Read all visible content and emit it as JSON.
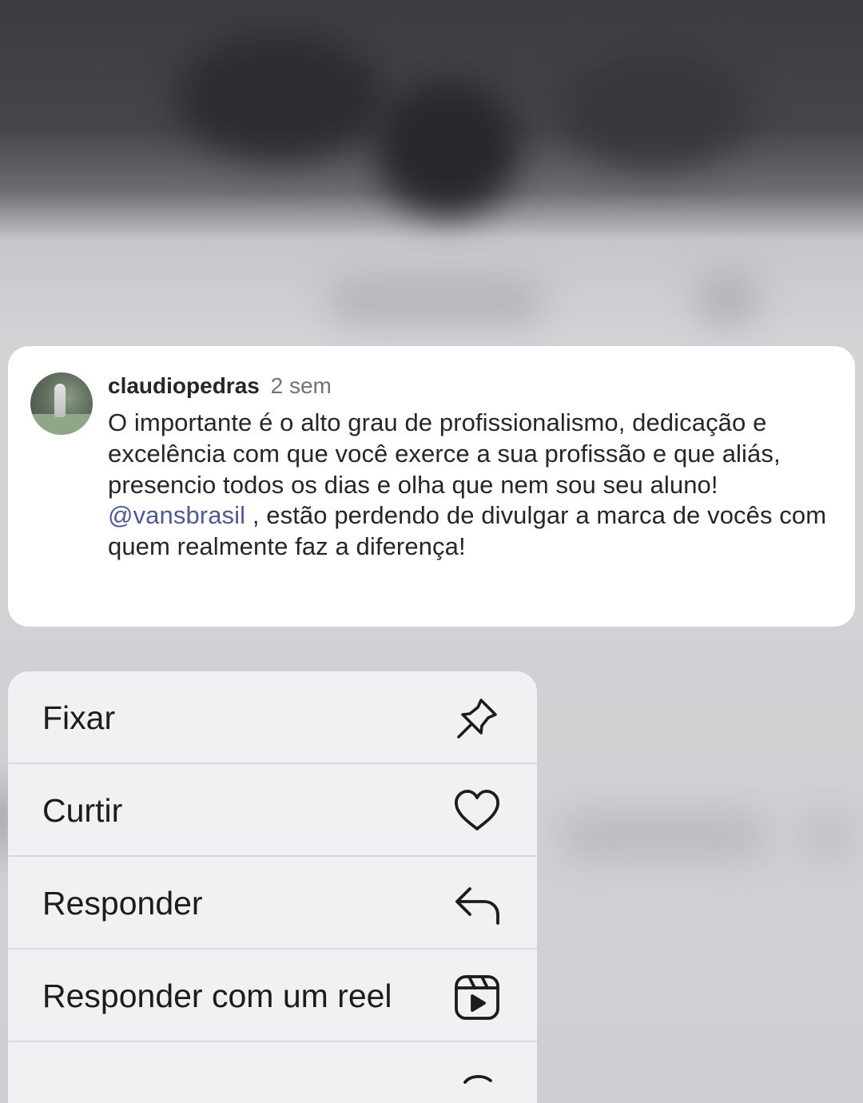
{
  "comment": {
    "username": "claudiopedras",
    "timestamp": "2 sem",
    "text_before_mention": "O importante é o alto grau de profissionalismo, dedicação e excelência com que você exerce a sua profissão e que aliás, presencio todos os dias e olha que nem sou seu aluno! ",
    "mention": "@vansbrasil",
    "text_after_mention": " , estão perdendo de divulgar a marca de vocês com quem realmente faz a diferença!"
  },
  "menu": {
    "items": [
      {
        "label": "Fixar",
        "icon": "pin-icon"
      },
      {
        "label": "Curtir",
        "icon": "heart-icon"
      },
      {
        "label": "Responder",
        "icon": "reply-arrow-icon"
      },
      {
        "label": "Responder com um reel",
        "icon": "reels-icon"
      },
      {
        "label": "",
        "icon": "partially-visible-icon"
      }
    ]
  },
  "colors": {
    "mention": "#4c5a9a",
    "menu_background": "#f1f1f3",
    "card_background": "#ffffff",
    "text_primary": "#262626",
    "text_secondary": "#737373"
  }
}
